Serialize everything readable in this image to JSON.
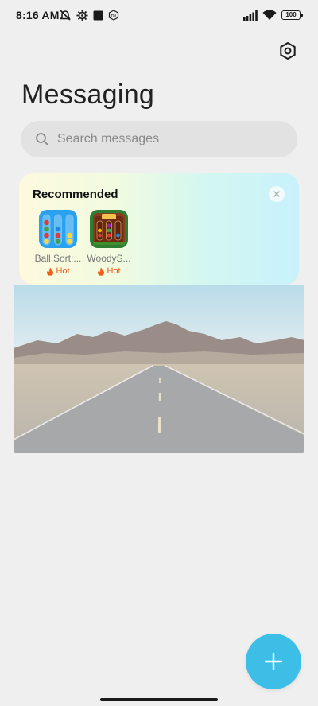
{
  "status_bar": {
    "time": "8:16 AM",
    "battery": "100",
    "left_icons": [
      "mute-icon",
      "settings-gear-icon",
      "square-notification-icon",
      "mi-icon"
    ],
    "right_icons": [
      "signal-icon",
      "wifi-icon",
      "battery-icon"
    ]
  },
  "header": {
    "title": "Messaging",
    "settings_icon": "settings-icon"
  },
  "search": {
    "placeholder": "Search messages",
    "icon": "search-icon"
  },
  "recommended": {
    "title": "Recommended",
    "close_icon": "close-icon",
    "apps": [
      {
        "name": "Ball Sort:...",
        "badge": "Hot",
        "badge_icon": "flame-icon"
      },
      {
        "name": "WoodyS...",
        "badge": "Hot",
        "badge_icon": "flame-icon"
      }
    ]
  },
  "fab": {
    "icon": "plus-icon"
  },
  "colors": {
    "accent": "#3cbee7",
    "hot": "#f05a12",
    "background": "#efefef",
    "search_bg": "#e2e2e2"
  }
}
